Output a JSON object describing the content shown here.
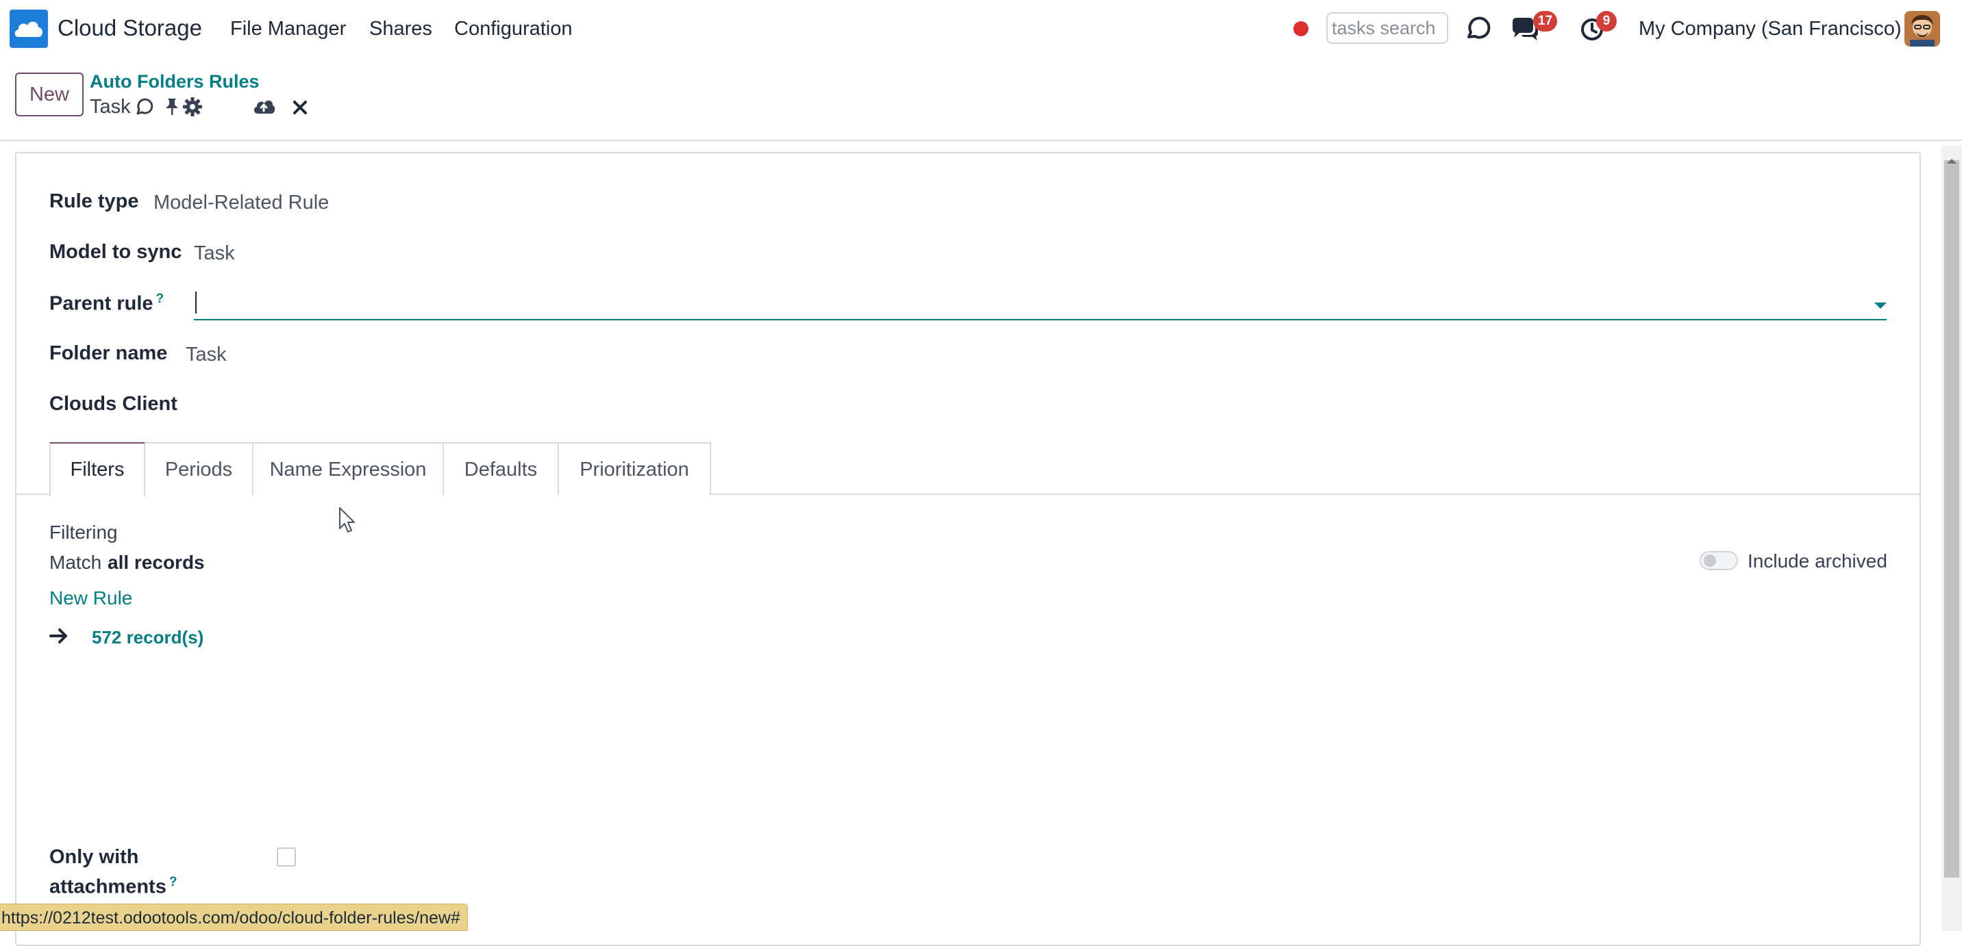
{
  "navbar": {
    "app_name": "Cloud Storage",
    "menu": [
      "File Manager",
      "Shares",
      "Configuration"
    ],
    "search_placeholder": "tasks search",
    "messages_count": "17",
    "activities_count": "9",
    "company": "My Company (San Francisco)",
    "colors": {
      "badge": "#d23f3a",
      "recording": "#dc2f2f",
      "logo": "#1f7fd8"
    }
  },
  "control_panel": {
    "new_label": "New",
    "breadcrumb": "Auto Folders Rules",
    "record_title": "Task",
    "icons": [
      "sync-icon",
      "pin-icon",
      "gear-icon",
      "cloud-upload-icon",
      "close-icon"
    ]
  },
  "form": {
    "rule_type_label": "Rule type",
    "rule_type_value": "Model-Related Rule",
    "model_label": "Model to sync",
    "model_value": "Task",
    "parent_rule_label": "Parent rule",
    "parent_rule_value": "",
    "help_mark": "?",
    "folder_name_label": "Folder name",
    "folder_name_value": "Task",
    "clouds_client_label": "Clouds Client",
    "tabs": [
      "Filters",
      "Periods",
      "Name Expression",
      "Defaults",
      "Prioritization"
    ],
    "active_tab": "Filters",
    "filtering": {
      "title": "Filtering",
      "match_prefix": "Match",
      "match_bold": "all records",
      "new_rule": "New Rule",
      "records": "572 record(s)",
      "include_archived": "Include archived",
      "include_archived_on": false
    },
    "only_attachments_line1": "Only with",
    "only_attachments_line2": "attachments",
    "only_attachments_checked": false
  },
  "status_url": "https://0212test.odootools.com/odoo/cloud-folder-rules/new#",
  "accent_colors": {
    "primary": "#714b67",
    "link": "#017e84"
  }
}
